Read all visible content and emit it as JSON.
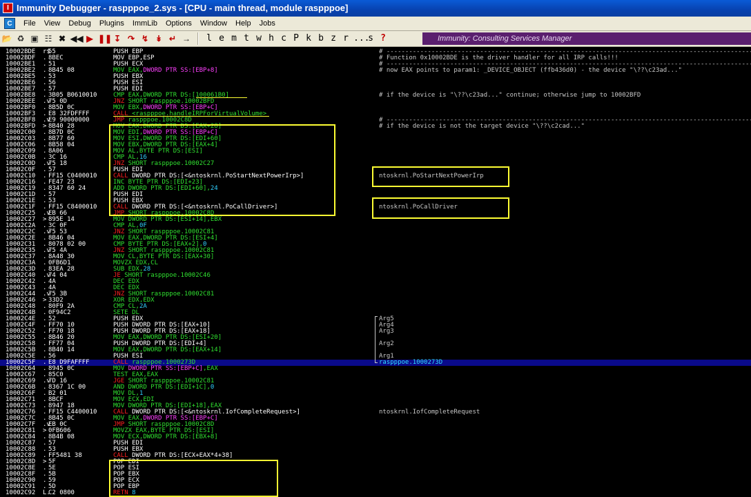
{
  "window": {
    "title": "Immunity Debugger - raspppoe_2.sys - [CPU - main thread, module raspppoe]",
    "icon": "immunity-app-icon"
  },
  "menu": {
    "items": [
      "File",
      "View",
      "Debug",
      "Plugins",
      "ImmLib",
      "Options",
      "Window",
      "Help",
      "Jobs"
    ]
  },
  "toolbar": {
    "letters": [
      "l",
      "e",
      "m",
      "t",
      "w",
      "h",
      "c",
      "P",
      "k",
      "b",
      "z",
      "r",
      "...",
      "s",
      "?"
    ],
    "banner": "Immunity: Consulting Services Manager"
  },
  "colors": {
    "mnemonic": "#ffffff",
    "call_jump": "#ff2020",
    "operand_green": "#30e030",
    "stack_magenta": "#ff40ff",
    "address_cyan": "#30e0ff",
    "immediate_cyan": "#30d0ff",
    "highlight": "#ffff33"
  },
  "rows": [
    {
      "a": "10002BDE",
      "m": "r$",
      "h": "55",
      "d": [
        [
          "PUSH EBP",
          "w"
        ]
      ],
      "c": "# ---------------------------------------------------------------------------------------------------------"
    },
    {
      "a": "10002BDF",
      "m": ".",
      "h": "8BEC",
      "d": [
        [
          "MOV EBP,ESP",
          "w"
        ]
      ],
      "c": "# Function 0x10002BDE is the driver handler for all IRP calls!!!"
    },
    {
      "a": "10002BE1",
      "m": ".",
      "h": "51",
      "d": [
        [
          "PUSH ECX",
          "w"
        ]
      ],
      "c": "# ---------------------------------------------------------------------------------------------------------"
    },
    {
      "a": "10002BE2",
      "m": ".",
      "h": "8B45 08",
      "d": [
        [
          "MOV EAX,",
          "g"
        ],
        [
          "DWORD PTR SS:[EBP+8]",
          "p"
        ]
      ],
      "c": "# now EAX points to  param1: _DEVICE_OBJECT (ffb436d0) - the device \"\\??\\c23ad...\""
    },
    {
      "a": "10002BE5",
      "m": ".",
      "h": "53",
      "d": [
        [
          "PUSH EBX",
          "w"
        ]
      ],
      "c": ""
    },
    {
      "a": "10002BE6",
      "m": ".",
      "h": "56",
      "d": [
        [
          "PUSH ESI",
          "w"
        ]
      ],
      "c": ""
    },
    {
      "a": "10002BE7",
      "m": ".",
      "h": "57",
      "d": [
        [
          "PUSH EDI",
          "w"
        ]
      ],
      "c": ""
    },
    {
      "a": "10002BE8",
      "m": ".",
      "h": "3B05 B0610010",
      "d": [
        [
          "CMP EAX,DWORD PTR DS:[100061B0]",
          "g"
        ]
      ],
      "c": "# if the device is \"\\??\\c23ad...\" continue; otherwise jump to 10002BFD"
    },
    {
      "a": "10002BEE",
      "m": ".v",
      "h": "75 0D",
      "d": [
        [
          "JNZ",
          "r"
        ],
        [
          " SHORT raspppoe.10002BFD",
          "g"
        ]
      ],
      "c": ""
    },
    {
      "a": "10002BF0",
      "m": ".",
      "h": "8B5D 0C",
      "d": [
        [
          "MOV EBX,",
          "g"
        ],
        [
          "DWORD PTR SS:[EBP+C]",
          "p"
        ]
      ],
      "c": ""
    },
    {
      "a": "10002BF3",
      "m": ".",
      "h": "E8 32FDFFFF",
      "d": [
        [
          "CALL",
          "r"
        ],
        [
          " <raspppoe.handleIRPForVirtualVolume>",
          "g"
        ]
      ],
      "c": ""
    },
    {
      "a": "10002BF8",
      "m": ".v",
      "h": "E9 90000000",
      "d": [
        [
          "JMP",
          "r"
        ],
        [
          " raspppoe.10002C8D",
          "g"
        ]
      ],
      "c": "# ---------------------------------------------------------------------------------------------------------"
    },
    {
      "a": "10002BFD",
      "m": ">",
      "h": "8B40 28",
      "d": [
        [
          "MOV EAX,DWORD PTR DS:[EAX+28]",
          "g"
        ]
      ],
      "c": "# if the device is not the target device \"\\??\\c2cad...\""
    },
    {
      "a": "10002C00",
      "m": ".",
      "h": "8B7D 0C",
      "d": [
        [
          "MOV EDI,",
          "g"
        ],
        [
          "DWORD PTR SS:[EBP+C]",
          "p"
        ]
      ],
      "c": ""
    },
    {
      "a": "10002C03",
      "m": ".",
      "h": "8B77 60",
      "d": [
        [
          "MOV ESI,DWORD PTR DS:[EDI+60]",
          "g"
        ]
      ],
      "c": ""
    },
    {
      "a": "10002C06",
      "m": ".",
      "h": "8B58 04",
      "d": [
        [
          "MOV EBX,DWORD PTR DS:[EAX+4]",
          "g"
        ]
      ],
      "c": ""
    },
    {
      "a": "10002C09",
      "m": ".",
      "h": "8A06",
      "d": [
        [
          "MOV AL,BYTE PTR DS:[ESI]",
          "g"
        ]
      ],
      "c": ""
    },
    {
      "a": "10002C0B",
      "m": ".",
      "h": "3C 16",
      "d": [
        [
          "CMP AL,",
          "g"
        ],
        [
          "16",
          "c"
        ]
      ],
      "c": ""
    },
    {
      "a": "10002C0D",
      "m": ".v",
      "h": "75 18",
      "d": [
        [
          "JNZ",
          "r"
        ],
        [
          " SHORT raspppoe.10002C27",
          "g"
        ]
      ],
      "c": ""
    },
    {
      "a": "10002C0F",
      "m": ".",
      "h": "57",
      "d": [
        [
          "PUSH EDI",
          "w"
        ]
      ],
      "c": ""
    },
    {
      "a": "10002C10",
      "m": ".",
      "h": "FF15 C0400010",
      "d": [
        [
          "CALL",
          "r"
        ],
        [
          " DWORD PTR DS:[<&ntoskrnl.PoStartNextPowerIrp>]",
          "w"
        ]
      ],
      "c": "ntoskrnl.PoStartNextPowerIrp"
    },
    {
      "a": "10002C16",
      "m": ".",
      "h": "FE47 23",
      "d": [
        [
          "INC BYTE PTR DS:[EDI+23]",
          "g"
        ]
      ],
      "c": ""
    },
    {
      "a": "10002C19",
      "m": ".",
      "h": "8347 60 24",
      "d": [
        [
          "ADD DWORD PTR DS:[EDI+60],",
          "g"
        ],
        [
          "24",
          "c"
        ]
      ],
      "c": ""
    },
    {
      "a": "10002C1D",
      "m": ".",
      "h": "57",
      "d": [
        [
          "PUSH EDI",
          "w"
        ]
      ],
      "c": ""
    },
    {
      "a": "10002C1E",
      "m": ".",
      "h": "53",
      "d": [
        [
          "PUSH EBX",
          "w"
        ]
      ],
      "c": ""
    },
    {
      "a": "10002C1F",
      "m": ".",
      "h": "FF15 C8400010",
      "d": [
        [
          "CALL",
          "r"
        ],
        [
          " DWORD PTR DS:[<&ntoskrnl.PoCallDriver>]",
          "w"
        ]
      ],
      "c": "ntoskrnl.PoCallDriver"
    },
    {
      "a": "10002C25",
      "m": ".v",
      "h": "EB 66",
      "d": [
        [
          "JMP",
          "r"
        ],
        [
          " SHORT raspppoe.10002C8D",
          "g"
        ]
      ],
      "c": ""
    },
    {
      "a": "10002C27",
      "m": ">",
      "h": "895E 14",
      "d": [
        [
          "MOV DWORD PTR DS:[ESI+14],EBX",
          "g"
        ]
      ],
      "c": ""
    },
    {
      "a": "10002C2A",
      "m": ".",
      "h": "3C 0F",
      "d": [
        [
          "CMP AL,",
          "g"
        ],
        [
          "0F",
          "c"
        ]
      ],
      "c": ""
    },
    {
      "a": "10002C2C",
      "m": ".v",
      "h": "75 53",
      "d": [
        [
          "JNZ",
          "r"
        ],
        [
          " SHORT raspppoe.10002C81",
          "g"
        ]
      ],
      "c": ""
    },
    {
      "a": "10002C2E",
      "m": ".",
      "h": "8B46 04",
      "d": [
        [
          "MOV EAX,DWORD PTR DS:[ESI+4]",
          "g"
        ]
      ],
      "c": ""
    },
    {
      "a": "10002C31",
      "m": ".",
      "h": "8078 02 00",
      "d": [
        [
          "CMP BYTE PTR DS:[EAX+2],",
          "g"
        ],
        [
          "0",
          "c"
        ]
      ],
      "c": ""
    },
    {
      "a": "10002C35",
      "m": ".v",
      "h": "75 4A",
      "d": [
        [
          "JNZ",
          "r"
        ],
        [
          " SHORT raspppoe.10002C81",
          "g"
        ]
      ],
      "c": ""
    },
    {
      "a": "10002C37",
      "m": ".",
      "h": "8A48 30",
      "d": [
        [
          "MOV CL,BYTE PTR DS:[EAX+30]",
          "g"
        ]
      ],
      "c": ""
    },
    {
      "a": "10002C3A",
      "m": ".",
      "h": "0FB6D1",
      "d": [
        [
          "MOVZX EDX,CL",
          "g"
        ]
      ],
      "c": ""
    },
    {
      "a": "10002C3D",
      "m": ".",
      "h": "83EA 28",
      "d": [
        [
          "SUB EDX,",
          "g"
        ],
        [
          "28",
          "c"
        ]
      ],
      "c": ""
    },
    {
      "a": "10002C40",
      "m": ".v",
      "h": "74 04",
      "d": [
        [
          "JE",
          "r"
        ],
        [
          " SHORT raspppoe.10002C46",
          "g"
        ]
      ],
      "c": ""
    },
    {
      "a": "10002C42",
      "m": ".",
      "h": "4A",
      "d": [
        [
          "DEC EDX",
          "g"
        ]
      ],
      "c": ""
    },
    {
      "a": "10002C43",
      "m": ".",
      "h": "4A",
      "d": [
        [
          "DEC EDX",
          "g"
        ]
      ],
      "c": ""
    },
    {
      "a": "10002C44",
      "m": ".v",
      "h": "75 3B",
      "d": [
        [
          "JNZ",
          "r"
        ],
        [
          " SHORT raspppoe.10002C81",
          "g"
        ]
      ],
      "c": ""
    },
    {
      "a": "10002C46",
      "m": ">",
      "h": "33D2",
      "d": [
        [
          "XOR EDX,EDX",
          "g"
        ]
      ],
      "c": ""
    },
    {
      "a": "10002C48",
      "m": ".",
      "h": "80F9 2A",
      "d": [
        [
          "CMP CL,",
          "g"
        ],
        [
          "2A",
          "c"
        ]
      ],
      "c": ""
    },
    {
      "a": "10002C4B",
      "m": ".",
      "h": "0F94C2",
      "d": [
        [
          "SETE DL",
          "g"
        ]
      ],
      "c": ""
    },
    {
      "a": "10002C4E",
      "m": ".",
      "h": "52",
      "d": [
        [
          "PUSH EDX",
          "w"
        ]
      ],
      "c": "Arg5"
    },
    {
      "a": "10002C4F",
      "m": ".",
      "h": "FF70 10",
      "d": [
        [
          "PUSH DWORD PTR DS:[EAX+10]",
          "w"
        ]
      ],
      "c": "Arg4"
    },
    {
      "a": "10002C52",
      "m": ".",
      "h": "FF70 18",
      "d": [
        [
          "PUSH DWORD PTR DS:[EAX+18]",
          "w"
        ]
      ],
      "c": "Arg3"
    },
    {
      "a": "10002C55",
      "m": ".",
      "h": "8B46 20",
      "d": [
        [
          "MOV EAX,DWORD PTR DS:[ESI+20]",
          "g"
        ]
      ],
      "c": ""
    },
    {
      "a": "10002C58",
      "m": ".",
      "h": "FF77 04",
      "d": [
        [
          "PUSH DWORD PTR DS:[EDI+4]",
          "w"
        ]
      ],
      "c": "Arg2"
    },
    {
      "a": "10002C5B",
      "m": ".",
      "h": "8B40 14",
      "d": [
        [
          "MOV EAX,DWORD PTR DS:[EAX+14]",
          "g"
        ]
      ],
      "c": ""
    },
    {
      "a": "10002C5E",
      "m": ".",
      "h": "56",
      "d": [
        [
          "PUSH ESI",
          "w"
        ]
      ],
      "c": "Arg1"
    },
    {
      "a": "10002C5F",
      "m": ".",
      "h": "E8 D9FAFFFF",
      "d": [
        [
          "CALL",
          "r"
        ],
        [
          " raspppoe.1000273D",
          "g"
        ]
      ],
      "c": "raspppoe.1000273D",
      "sel": true
    },
    {
      "a": "10002C64",
      "m": ".",
      "h": "8945 0C",
      "d": [
        [
          "MOV ",
          "g"
        ],
        [
          "DWORD PTR SS:[EBP+C]",
          "p"
        ],
        [
          ",EAX",
          "g"
        ]
      ],
      "c": ""
    },
    {
      "a": "10002C67",
      "m": ".",
      "h": "85C0",
      "d": [
        [
          "TEST EAX,EAX",
          "g"
        ]
      ],
      "c": ""
    },
    {
      "a": "10002C69",
      "m": ".v",
      "h": "7D 16",
      "d": [
        [
          "JGE",
          "r"
        ],
        [
          " SHORT raspppoe.10002C81",
          "g"
        ]
      ],
      "c": ""
    },
    {
      "a": "10002C6B",
      "m": ".",
      "h": "8367 1C 00",
      "d": [
        [
          "AND DWORD PTR DS:[EDI+1C],",
          "g"
        ],
        [
          "0",
          "c"
        ]
      ],
      "c": ""
    },
    {
      "a": "10002C6F",
      "m": ".",
      "h": "B2 01",
      "d": [
        [
          "MOV DL,",
          "g"
        ],
        [
          "1",
          "c"
        ]
      ],
      "c": ""
    },
    {
      "a": "10002C71",
      "m": ".",
      "h": "8BCF",
      "d": [
        [
          "MOV ECX,EDI",
          "g"
        ]
      ],
      "c": ""
    },
    {
      "a": "10002C73",
      "m": ".",
      "h": "8947 18",
      "d": [
        [
          "MOV DWORD PTR DS:[EDI+18],EAX",
          "g"
        ]
      ],
      "c": ""
    },
    {
      "a": "10002C76",
      "m": ".",
      "h": "FF15 C4400010",
      "d": [
        [
          "CALL",
          "r"
        ],
        [
          " DWORD PTR DS:[<&ntoskrnl.IofCompleteRequest>]",
          "w"
        ]
      ],
      "c": "ntoskrnl.IofCompleteRequest"
    },
    {
      "a": "10002C7C",
      "m": ".",
      "h": "8B45 0C",
      "d": [
        [
          "MOV EAX,",
          "g"
        ],
        [
          "DWORD PTR SS:[EBP+C]",
          "p"
        ]
      ],
      "c": ""
    },
    {
      "a": "10002C7F",
      "m": ".v",
      "h": "EB 0C",
      "d": [
        [
          "JMP",
          "r"
        ],
        [
          " SHORT raspppoe.10002C8D",
          "g"
        ]
      ],
      "c": ""
    },
    {
      "a": "10002C81",
      "m": ">",
      "h": "0FB606",
      "d": [
        [
          "MOVZX EAX,BYTE PTR DS:[ESI]",
          "g"
        ]
      ],
      "c": ""
    },
    {
      "a": "10002C84",
      "m": ".",
      "h": "8B4B 08",
      "d": [
        [
          "MOV ECX,DWORD PTR DS:[EBX+8]",
          "g"
        ]
      ],
      "c": ""
    },
    {
      "a": "10002C87",
      "m": ".",
      "h": "57",
      "d": [
        [
          "PUSH EDI",
          "w"
        ]
      ],
      "c": ""
    },
    {
      "a": "10002C88",
      "m": ".",
      "h": "53",
      "d": [
        [
          "PUSH EBX",
          "w"
        ]
      ],
      "c": ""
    },
    {
      "a": "10002C89",
      "m": ".",
      "h": "FF5481 38",
      "d": [
        [
          "CALL",
          "r"
        ],
        [
          " DWORD PTR DS:[ECX+EAX*4+38]",
          "w"
        ]
      ],
      "c": ""
    },
    {
      "a": "10002C8D",
      "m": ">",
      "h": "5F",
      "d": [
        [
          "POP EDI",
          "w"
        ]
      ],
      "c": ""
    },
    {
      "a": "10002C8E",
      "m": ".",
      "h": "5E",
      "d": [
        [
          "POP ESI",
          "w"
        ]
      ],
      "c": ""
    },
    {
      "a": "10002C8F",
      "m": ".",
      "h": "5B",
      "d": [
        [
          "POP EBX",
          "w"
        ]
      ],
      "c": ""
    },
    {
      "a": "10002C90",
      "m": ".",
      "h": "59",
      "d": [
        [
          "POP ECX",
          "w"
        ]
      ],
      "c": ""
    },
    {
      "a": "10002C91",
      "m": ".",
      "h": "5D",
      "d": [
        [
          "POP EBP",
          "w"
        ]
      ],
      "c": ""
    },
    {
      "a": "10002C92",
      "m": "L.",
      "h": "C2 0800",
      "d": [
        [
          "RETN",
          "r"
        ],
        [
          " 8",
          "c"
        ]
      ],
      "c": ""
    }
  ]
}
